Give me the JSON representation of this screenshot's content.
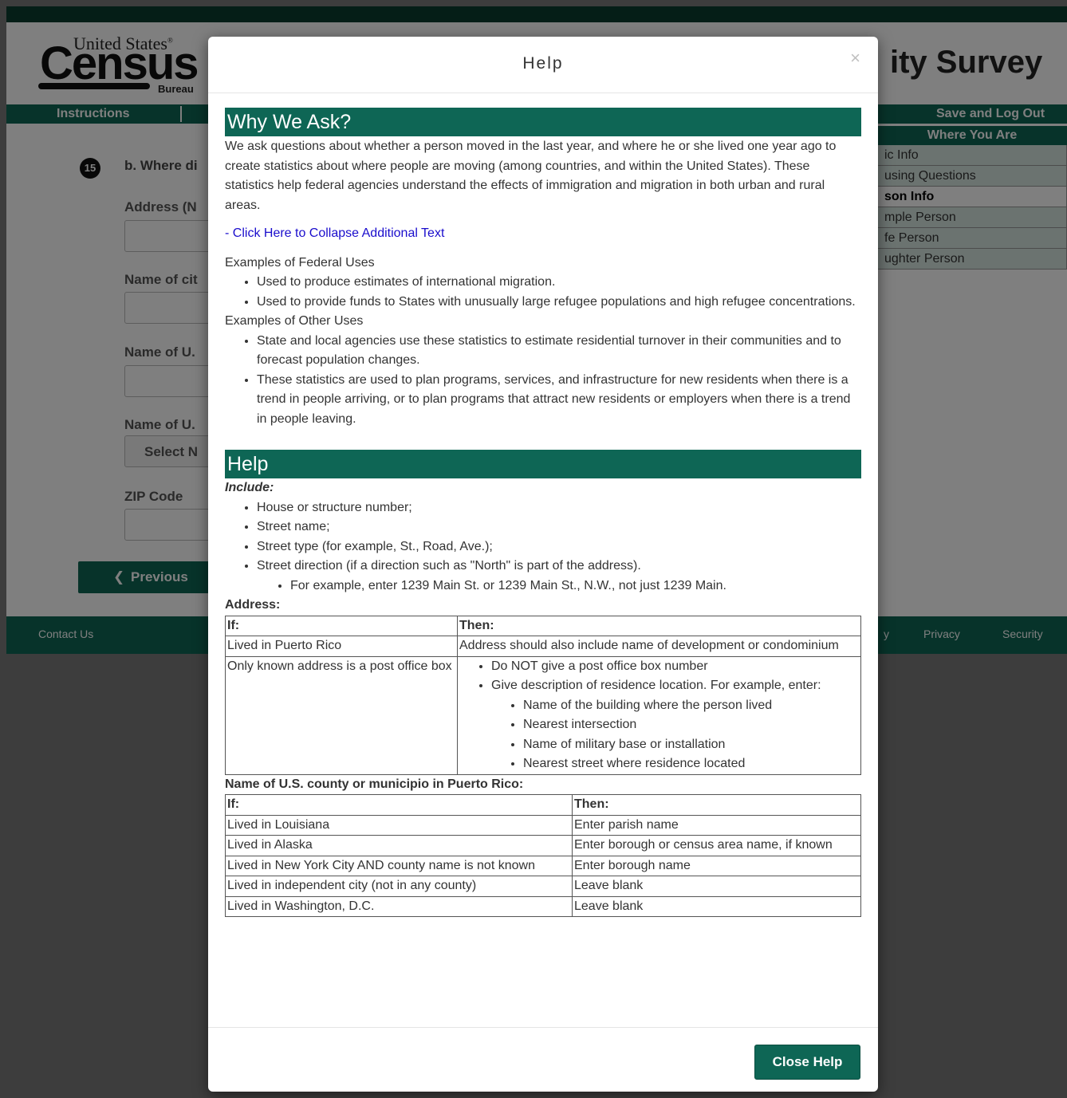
{
  "logo": {
    "top_text": "United States",
    "registered": "®",
    "main_text": "Census",
    "bureau_text": "Bureau"
  },
  "survey_title": "ity Survey",
  "nav": {
    "instructions": "Instructions",
    "save_logout": "Save and Log Out"
  },
  "side_panel": {
    "header": "Where You Are",
    "items": [
      "ic Info",
      "using Questions",
      "son Info",
      "mple Person",
      "fe Person",
      "ughter Person"
    ]
  },
  "question": {
    "number": "15",
    "text": "b. Where di"
  },
  "fields": {
    "address_label": "Address (N",
    "city_label": "Name of cit",
    "county_label": "Name of U.",
    "state_label": "Name of U.",
    "state_select": "Select N",
    "zip_label": "ZIP Code"
  },
  "buttons": {
    "previous": "Previous"
  },
  "footer": {
    "contact": "Contact Us",
    "accessibility": "y",
    "privacy": "Privacy",
    "security": "Security"
  },
  "modal": {
    "title": "Help",
    "close_symbol": "×",
    "why_heading": "Why We Ask?",
    "why_text": "We ask questions about whether a person moved in the last year, and where he or she lived one year ago to create statistics about where people are moving (among countries, and within the United States). These statistics help federal agencies understand the effects of immigration and migration in both urban and rural areas.",
    "collapse_link": "- Click Here to Collapse Additional Text",
    "federal_heading": "Examples of Federal Uses",
    "federal_uses": [
      "Used to produce estimates of international migration.",
      "Used to provide funds to States with unusually large refugee populations and high refugee concentrations."
    ],
    "other_heading": "Examples of Other Uses",
    "other_uses": [
      "State and local agencies use these statistics to estimate residential turnover in their communities and to forecast population changes.",
      "These statistics are used to plan programs, services, and infrastructure for new residents when there is a trend in people arriving, or to plan programs that attract new residents or employers when there is a trend in people leaving."
    ],
    "help_heading": "Help",
    "include_label": "Include:",
    "include_items": [
      "House or structure number;",
      "Street name;",
      "Street type (for example, St., Road, Ave.);",
      "Street direction (if a direction such as \"North\" is part of the address)."
    ],
    "include_sub": "For example, enter 1239 Main St. or 1239 Main St., N.W., not just 1239 Main.",
    "address_label": "Address:",
    "address_table": {
      "headers": [
        "If:",
        "Then:"
      ],
      "row1": [
        "Lived in Puerto Rico",
        "Address should also include name of development or condominium"
      ],
      "row2_if": "Only known address is a post office box",
      "row2_then": [
        "Do NOT give a post office box number",
        "Give description of residence location. For example, enter:"
      ],
      "row2_sub": [
        "Name of the building where the person lived",
        "Nearest intersection",
        "Name of military base or installation",
        "Nearest street where residence located"
      ]
    },
    "county_label": "Name of U.S. county or municipio in Puerto Rico:",
    "county_table": {
      "headers": [
        "If:",
        "Then:"
      ],
      "rows": [
        [
          "Lived in Louisiana",
          "Enter parish name"
        ],
        [
          "Lived in Alaska",
          "Enter borough or census area name, if known"
        ],
        [
          "Lived in New York City AND county name is not known",
          "Enter borough name"
        ],
        [
          "Lived in independent city (not in any county)",
          "Leave blank"
        ],
        [
          "Lived in Washington, D.C.",
          "Leave blank"
        ]
      ]
    },
    "close_button": "Close Help"
  }
}
